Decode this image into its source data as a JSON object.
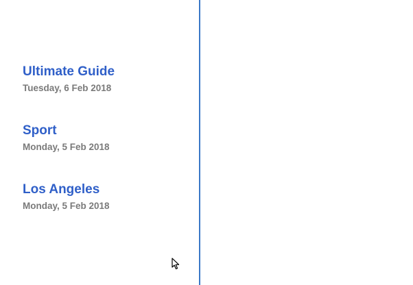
{
  "posts": [
    {
      "title": "Ultimate Guide",
      "date": "Tuesday, 6 Feb 2018"
    },
    {
      "title": "Sport",
      "date": "Monday, 5 Feb 2018"
    },
    {
      "title": "Los Angeles",
      "date": "Monday, 5 Feb 2018"
    }
  ],
  "colors": {
    "link": "#2f5fc8",
    "date": "#7a7a7a",
    "divider": "#3a78c7"
  },
  "icons": {
    "cursor": "mouse-pointer-icon"
  }
}
